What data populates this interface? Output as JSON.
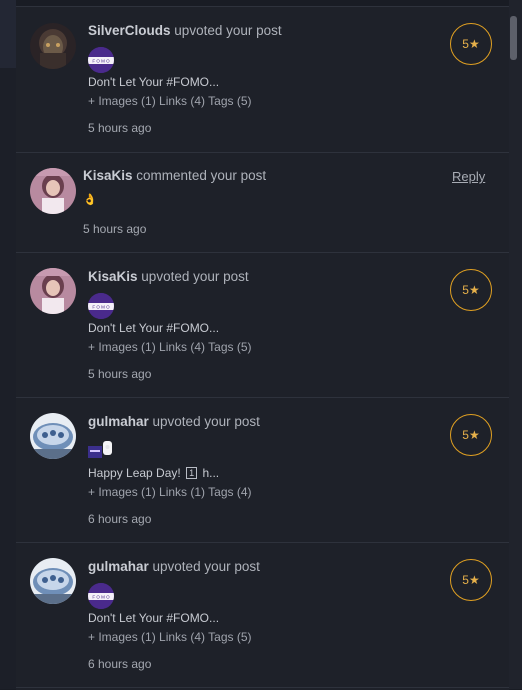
{
  "notifications": [
    {
      "username": "SilverClouds",
      "action": "upvoted your post",
      "excerpt": "Don't Let Your #FOMO...",
      "meta": "+ Images (1) Links (4) Tags (5)",
      "time": "5 hours ago",
      "vote": "5★"
    },
    {
      "username": "KisaKis",
      "action": "commented your post",
      "comment_emoji": "👌",
      "time": "5 hours ago",
      "reply_label": "Reply"
    },
    {
      "username": "KisaKis",
      "action": "upvoted your post",
      "excerpt": "Don't Let Your #FOMO...",
      "meta": "+ Images (1) Links (4) Tags (5)",
      "time": "5 hours ago",
      "vote": "5★"
    },
    {
      "username": "gulmahar",
      "action": "upvoted your post",
      "excerpt_prefix": "Happy Leap Day!",
      "excerpt_box": "1",
      "excerpt_suffix": "h...",
      "meta": "+ Images (1) Links (1) Tags (4)",
      "time": "6 hours ago",
      "vote": "5★"
    },
    {
      "username": "gulmahar",
      "action": "upvoted your post",
      "excerpt": "Don't Let Your #FOMO...",
      "meta": "+ Images (1) Links (4) Tags (5)",
      "time": "6 hours ago",
      "vote": "5★"
    }
  ],
  "thumb_text": "F O M O",
  "colors": {
    "accent": "#e0a022",
    "thumb": "#4a2a8c",
    "background": "#1e2129"
  }
}
